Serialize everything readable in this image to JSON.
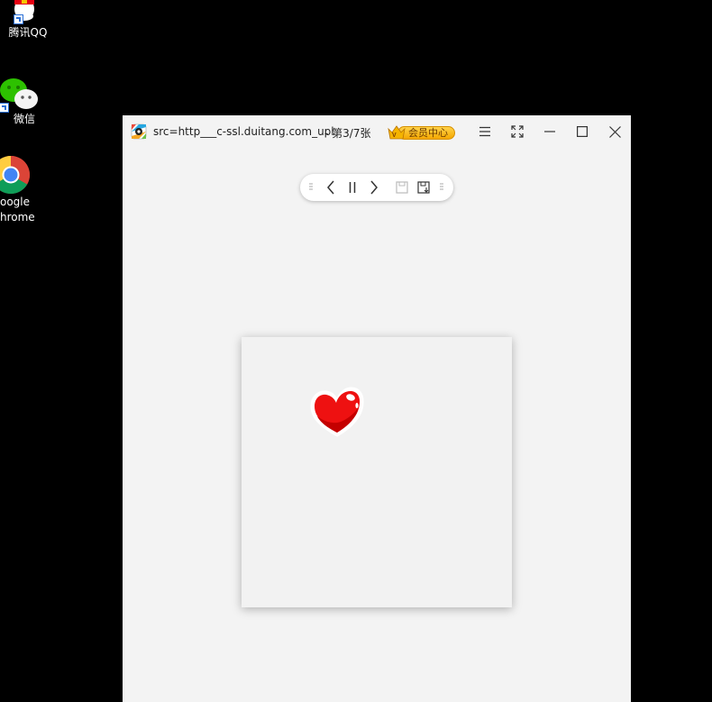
{
  "desktop": {
    "icons": [
      {
        "label": "腾讯QQ"
      },
      {
        "label": "微信"
      },
      {
        "label_line1": "oogle",
        "label_line2": "hrome"
      }
    ]
  },
  "viewer": {
    "title": "src=http___c-ssl.duitang.com_upl",
    "counter": "- 第3/7张",
    "vip_label": "会员中心",
    "title_buttons": [
      "menu-icon",
      "fullscreen-icon",
      "minimize-icon",
      "maximize-icon",
      "close-icon"
    ],
    "toolbar_icons": [
      "grip-icon",
      "previous-icon",
      "pause-icon",
      "next-icon",
      "save-icon",
      "save-as-icon",
      "grip-icon"
    ],
    "image_content": "heart"
  },
  "colors": {
    "window_background": "#f3f3f3",
    "desktop_background": "#000000",
    "heart": "#ee1111",
    "vip_gold": "#f5b400"
  }
}
